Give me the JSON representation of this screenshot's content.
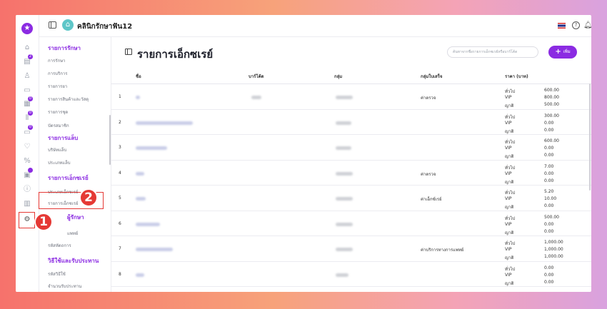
{
  "app": {
    "clinic_name": "คลินิกรักษาฟัน12",
    "logo_glyph": "★",
    "clinic_glyph": "⌂",
    "accent_color": "#8b2be2",
    "highlight_color": "#e53935"
  },
  "rail": {
    "icons": [
      {
        "name": "home-icon",
        "glyph": "⌂"
      },
      {
        "name": "calendar-icon",
        "glyph": "▤",
        "badge": "2"
      },
      {
        "name": "user-icon",
        "glyph": "♙"
      },
      {
        "name": "id-card-icon",
        "glyph": "▭"
      },
      {
        "name": "inventory-icon",
        "glyph": "▦",
        "badge": "0"
      },
      {
        "name": "chart-bar-icon",
        "glyph": "⫴",
        "badge": "0"
      },
      {
        "name": "payment-icon",
        "glyph": "▭",
        "badge": "0"
      },
      {
        "name": "tooth-icon",
        "glyph": "♡"
      },
      {
        "name": "percent-icon",
        "glyph": "%"
      },
      {
        "name": "report-icon",
        "glyph": "▣",
        "badge": " "
      },
      {
        "name": "info-icon",
        "glyph": "ⓘ"
      },
      {
        "name": "stats-icon",
        "glyph": "▥"
      },
      {
        "name": "gear-icon",
        "glyph": "⚙"
      }
    ]
  },
  "sidebar": {
    "sections": [
      {
        "title": "รายการรักษา",
        "items": [
          "การรักษา",
          "การบริการ",
          "รายการยา",
          "รายการสินค้าและวัสดุ",
          "รายการชุด",
          "บัตรสมาชิก"
        ]
      },
      {
        "title": "รายการแล็บ",
        "items": [
          "บริษัทแล็บ",
          "ประเภทแล็บ"
        ]
      },
      {
        "title": "รายการเอ็กซเรย์",
        "items": [
          "ประเภทเอ็กซเรย์",
          "รายการเอ็กซเรย์"
        ]
      },
      {
        "title": "ผู้รักษา",
        "items": [
          "แพทย์",
          "รหัสหัตถการ"
        ]
      },
      {
        "title": "วิธีใช้และรับประทาน",
        "items": [
          "รหัสวิธีใช้",
          "จำนวนรับประทาน"
        ]
      }
    ]
  },
  "callouts": {
    "one": "1",
    "two": "2"
  },
  "page": {
    "title": "รายการเอ็กซเรย์",
    "search_placeholder": "ค้นหาจากชื่อรายการเอ็กซเรย์หรือบาร์โค้ด",
    "add_label": "เพิ่ม"
  },
  "table": {
    "headers": {
      "name": "ชื่อ",
      "barcode": "บาร์โค้ด",
      "group": "กลุ่ม",
      "billing_group": "กลุ่มใบเสร็จ",
      "price": "ราคา (บาท)"
    },
    "price_labels": [
      "ทั่วไป",
      "VIP",
      "ญาติ"
    ],
    "rows": [
      {
        "no": "1",
        "billing_group": "ค่าตรวจ",
        "prices": [
          "600.00",
          "800.00",
          "500.00"
        ]
      },
      {
        "no": "2",
        "billing_group": "",
        "prices": [
          "300.00",
          "0.00",
          "0.00"
        ]
      },
      {
        "no": "3",
        "billing_group": "",
        "prices": [
          "600.00",
          "0.00",
          "0.00"
        ]
      },
      {
        "no": "4",
        "billing_group": "ค่าตรวจ",
        "prices": [
          "7.00",
          "0.00",
          "0.00"
        ]
      },
      {
        "no": "5",
        "billing_group": "ค่าเอ็กซ์เรย์",
        "prices": [
          "5.20",
          "10.00",
          "0.00"
        ]
      },
      {
        "no": "6",
        "billing_group": "",
        "prices": [
          "500.00",
          "0.00",
          "0.00"
        ]
      },
      {
        "no": "7",
        "billing_group": "ค่าบริการทางการแพทย์",
        "prices": [
          "1,000.00",
          "1,000.00",
          "1,000.00"
        ]
      },
      {
        "no": "8",
        "billing_group": "",
        "prices": [
          "0.00",
          "0.00",
          "0.00"
        ]
      }
    ]
  }
}
